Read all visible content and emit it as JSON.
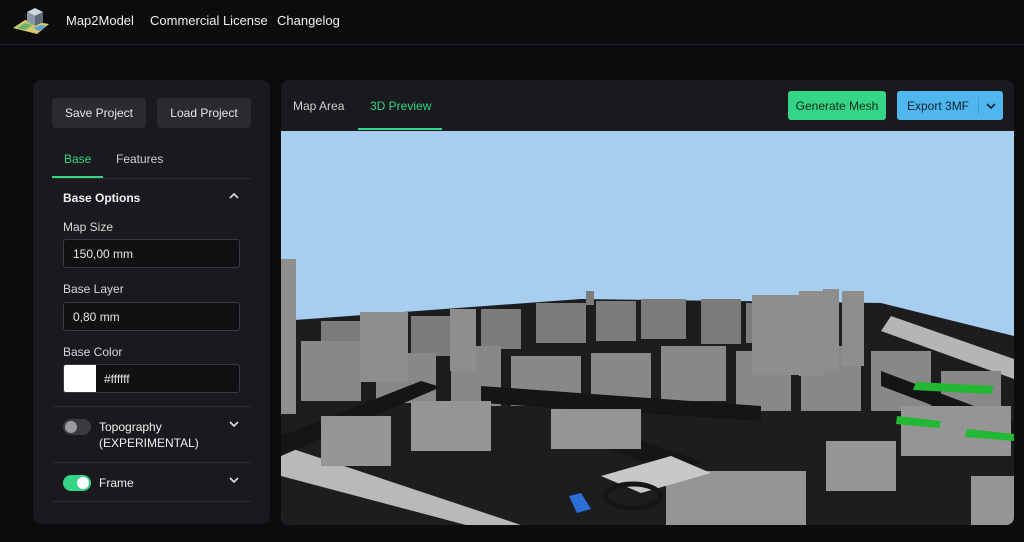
{
  "nav": {
    "brand": "Map2Model",
    "links": [
      "Commercial License",
      "Changelog"
    ]
  },
  "sidebar": {
    "save_label": "Save Project",
    "load_label": "Load Project",
    "tabs": [
      "Base",
      "Features"
    ],
    "active_tab": "Base",
    "section_title": "Base Options",
    "map_size": {
      "label": "Map Size",
      "value": "150,00 mm"
    },
    "base_layer": {
      "label": "Base Layer",
      "value": "0,80 mm"
    },
    "base_color": {
      "label": "Base Color",
      "value": "#ffffff"
    },
    "topography": {
      "label_line1": "Topography",
      "label_line2": "(EXPERIMENTAL)",
      "enabled": false
    },
    "frame": {
      "label": "Frame",
      "enabled": true
    }
  },
  "main": {
    "tabs": [
      "Map Area",
      "3D Preview"
    ],
    "active_tab": "3D Preview",
    "generate_label": "Generate Mesh",
    "export_label": "Export 3MF"
  },
  "colors": {
    "accent_green": "#34d587",
    "accent_blue": "#4fb6ee",
    "sky": "#a7cdef",
    "building": "#8a8a8a",
    "road": "#1c1c1e",
    "park": "#22b833"
  }
}
